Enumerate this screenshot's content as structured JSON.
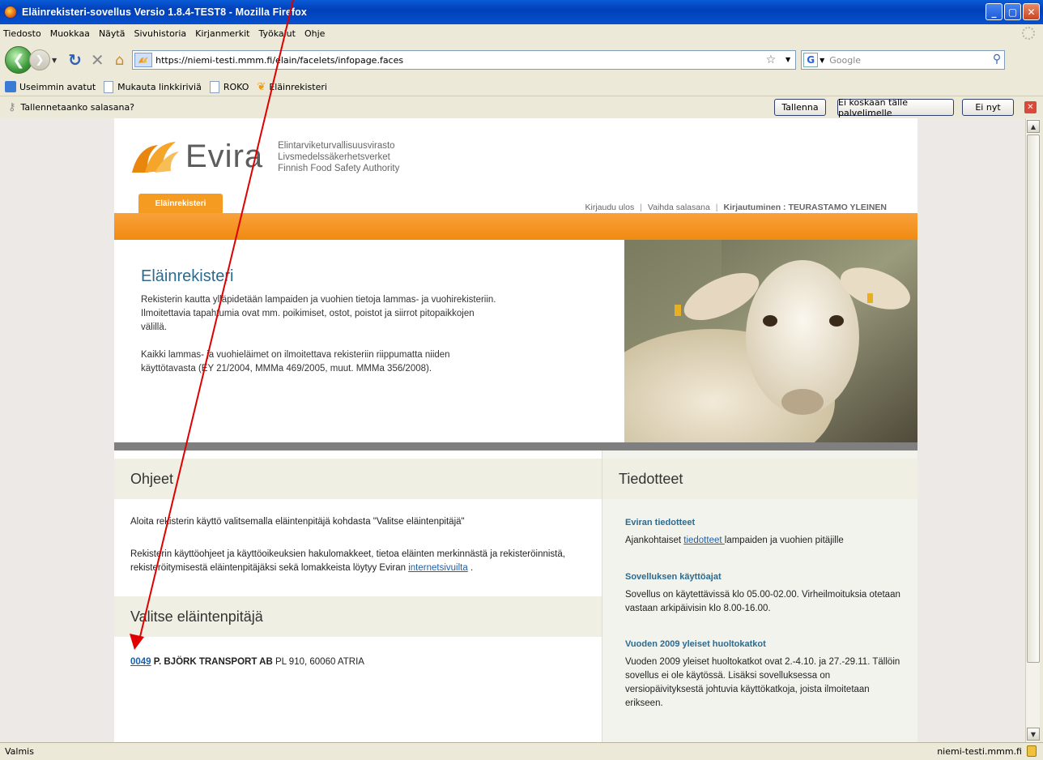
{
  "window": {
    "title": "Eläinrekisteri-sovellus Versio  1.8.4-TEST8 - Mozilla Firefox",
    "min": "_",
    "max": "▢",
    "close": "✕"
  },
  "menu": [
    "Tiedosto",
    "Muokkaa",
    "Näytä",
    "Sivuhistoria",
    "Kirjanmerkit",
    "Työkalut",
    "Ohje"
  ],
  "nav": {
    "url": "https://niemi-testi.mmm.fi/elain/facelets/infopage.faces",
    "search_engine": "G",
    "search_placeholder": "Google"
  },
  "bookmarks": [
    "Useimmin avatut",
    "Mukauta linkkiriviä",
    "ROKO",
    "Eläinrekisteri"
  ],
  "password_bar": {
    "question": "Tallennetaanko salasana?",
    "save": "Tallenna",
    "never": "Ei koskaan tälle palvelimelle",
    "not_now": "Ei nyt"
  },
  "site": {
    "logo_word": "Evira",
    "org_lines": [
      "Elintarviketurvallisuusvirasto",
      "Livsmedelssäkerhetsverket",
      "Finnish Food Safety Authority"
    ],
    "tab_label": "Eläinrekisteri",
    "links": {
      "logout": "Kirjaudu ulos",
      "change_password": "Vaihda salasana",
      "login_label": "Kirjautuminen : TEURASTAMO YLEINEN"
    }
  },
  "hero": {
    "title": "Eläinrekisteri",
    "para1": "Rekisterin kautta ylläpidetään lampaiden ja vuohien tietoja lammas- ja vuohirekisteriin. Ilmoitettavia tapahtumia ovat mm. poikimiset, ostot, poistot ja siirrot pitopaikkojen välillä.",
    "para2": "Kaikki lammas- ja vuohieläimet on ilmoitettava rekisteriin riippumatta niiden käyttötavasta (EY 21/2004, MMMa 469/2005, muut. MMMa 356/2008)."
  },
  "instructions": {
    "heading": "Ohjeet",
    "line1": "Aloita rekisterin käyttö valitsemalla eläintenpitäjä kohdasta \"Valitse eläintenpitäjä\"",
    "line2": "Rekisterin käyttöohjeet ja käyttöoikeuksien hakulomakkeet, tietoa eläinten merkinnästä ja rekisteröinnistä, rekisteröitymisestä eläintenpitäjäksi sekä lomakkeista löytyy Eviran",
    "line2_link": "internetsivuilta",
    "line2_end": "."
  },
  "select_keeper": {
    "heading": "Valitse eläintenpitäjä",
    "id": "0049",
    "name": "P. BJÖRK TRANSPORT AB",
    "address": "PL 910, 60060 ATRIA"
  },
  "announcements": {
    "heading": "Tiedotteet",
    "items": [
      {
        "title": "Eviran tiedotteet",
        "pre": "Ajankohtaiset ",
        "link": "tiedotteet ",
        "post": "lampaiden ja vuohien pitäjille"
      },
      {
        "title": "Sovelluksen käyttöajat",
        "text": "Sovellus on käytettävissä klo 05.00-02.00. Virheilmoituksia otetaan vastaan arkipäivisin klo 8.00-16.00."
      },
      {
        "title": "Vuoden 2009 yleiset huoltokatkot",
        "text": "Vuoden 2009 yleiset huoltokatkot ovat 2.-4.10. ja 27.-29.11. Tällöin sovellus ei ole käytössä. Lisäksi sovelluksessa on versiopäivityksestä johtuvia käyttökatkoja, joista ilmoitetaan erikseen."
      }
    ]
  },
  "status": {
    "text": "Valmis",
    "domain": "niemi-testi.mmm.fi"
  }
}
